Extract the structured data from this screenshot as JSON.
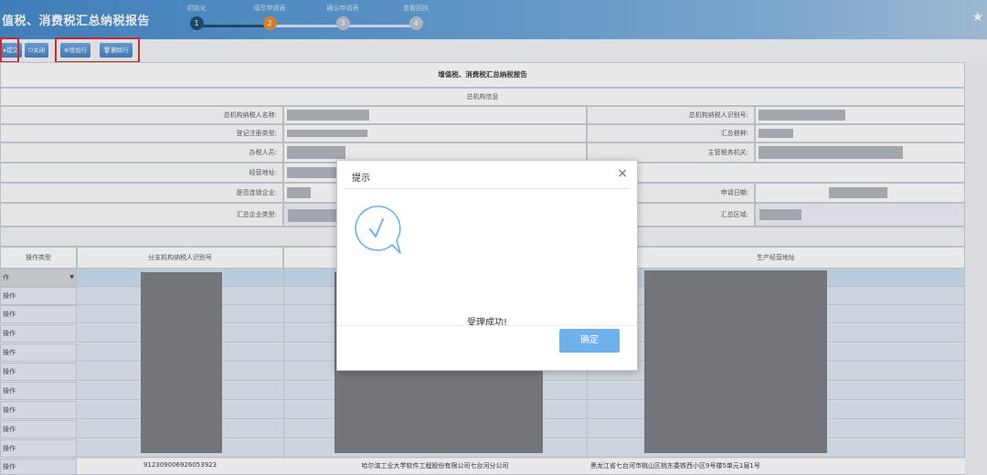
{
  "header": {
    "title": "值税、消费税汇总纳税报告",
    "steps": [
      {
        "label": "初始化",
        "number": "1",
        "state": "done"
      },
      {
        "label": "填写申请表",
        "number": "2",
        "state": "current"
      },
      {
        "label": "确认申请表",
        "number": "3",
        "state": "todo"
      },
      {
        "label": "查看回执",
        "number": "4",
        "state": "todo"
      }
    ]
  },
  "toolbar": {
    "submit_label": "提交",
    "close_label": "关闭",
    "add_row_label": "增加行",
    "delete_row_label": "删除行"
  },
  "form": {
    "report_title": "增值税、消费税汇总纳税报告",
    "section_title": "总机构信息",
    "fields": {
      "hq_name_label": "总机构纳税人名称:",
      "hq_id_label": "总机构纳税人识别号:",
      "reg_type_label": "登记注册类型:",
      "tax_type_label": "汇总税种:",
      "agent_label": "办税人员:",
      "authority_label": "主管税务机关:",
      "address_label": "经营地址:",
      "chain_label": "是否连锁企业:",
      "apply_date_label": "申请日期:",
      "ent_type_label": "汇总企业类型:",
      "region_label": "汇总区域:"
    },
    "table": {
      "headers": [
        "操作类型",
        "分支机构纳税人识别号",
        "",
        "生产经营地址"
      ],
      "rows": [
        {
          "op": "作"
        },
        {
          "op": "操作"
        },
        {
          "op": "操作"
        },
        {
          "op": "操作"
        },
        {
          "op": "操作"
        },
        {
          "op": "操作"
        },
        {
          "op": "操作"
        },
        {
          "op": "操作"
        },
        {
          "op": "操作"
        },
        {
          "op": "操作"
        }
      ],
      "last_row": {
        "op": "操作",
        "branch_id": "912309006926053923",
        "branch_name": "哈尔滨工业大学软件工程股份有限公司七台河分公司",
        "address": "黑龙江省七台河市桃山区桃东委铁西小区9号楼5单元1层1号"
      }
    }
  },
  "dialog": {
    "title": "提示",
    "close_glyph": "×",
    "message": "受理成功!",
    "ok_label": "确定"
  },
  "colors": {
    "header_blue": "#3f86c9",
    "step_done": "#17476d",
    "step_current": "#e28a2b",
    "step_todo": "#b9c3cf",
    "button_ok": "#6fb1ec",
    "highlight_red": "#d9262f",
    "icon_check": "#6fb1ec"
  },
  "icons": {
    "close_btn": "power-icon",
    "add_row": "plus-circle-icon",
    "delete_row": "trash-icon",
    "dialog": "speech-bubble-check-icon",
    "favorite": "star-icon"
  }
}
